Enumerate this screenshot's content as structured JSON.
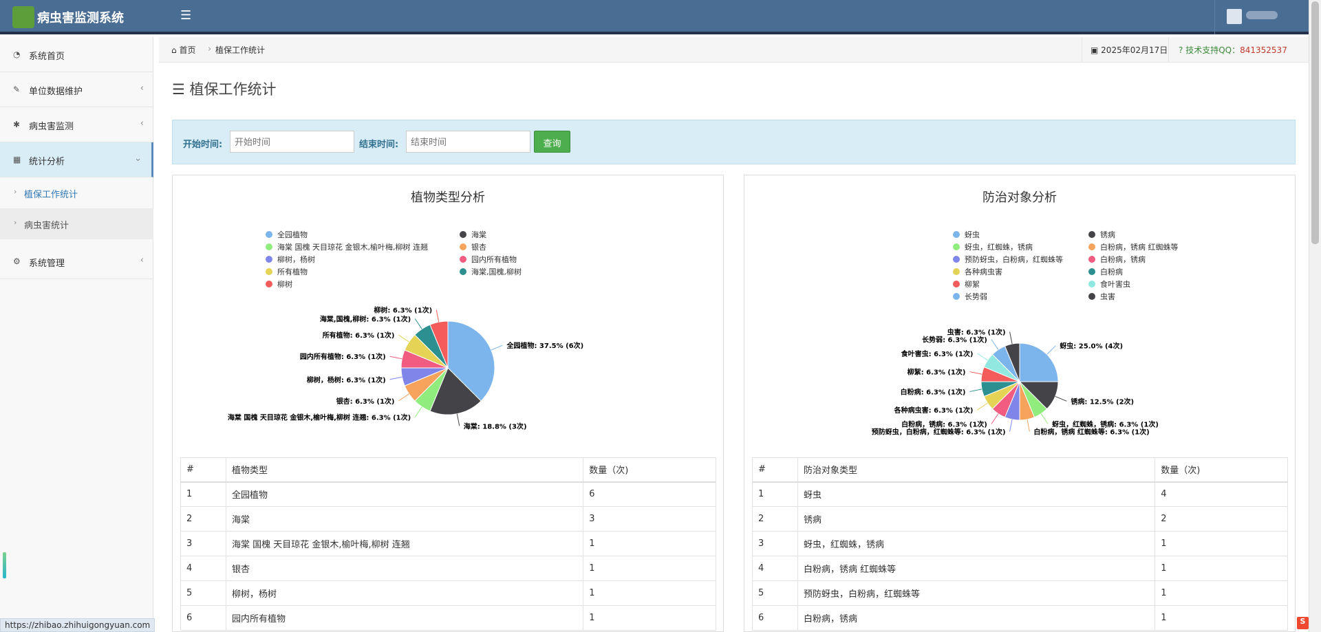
{
  "header": {
    "app_title": "病虫害监测系统",
    "menu_icon": "hamburger-icon"
  },
  "sidebar": {
    "items": [
      {
        "label": "系统首页",
        "icon": "dashboard-icon"
      },
      {
        "label": "单位数据维护",
        "icon": "edit-icon"
      },
      {
        "label": "病虫害监测",
        "icon": "bug-icon"
      },
      {
        "label": "统计分析",
        "icon": "chart-icon"
      },
      {
        "label": "系统管理",
        "icon": "gears-icon"
      }
    ],
    "subitems": [
      {
        "label": "植保工作统计"
      },
      {
        "label": "病虫害统计"
      }
    ]
  },
  "breadcrumb": {
    "home": "首页",
    "current": "植保工作统计"
  },
  "topinfo": {
    "date": "2025年02月17日",
    "support_label": "技术支持QQ：",
    "support_qq": "841352537"
  },
  "page": {
    "title": "植保工作统计"
  },
  "filter": {
    "start_label": "开始时间:",
    "start_placeholder": "开始时间",
    "end_label": "结束时间:",
    "end_placeholder": "结束时间",
    "query": "查询"
  },
  "url_hint": "https://zhibao.zhihuigongyuan.com",
  "chart_data": [
    {
      "type": "pie",
      "title": "植物类型分析",
      "slices": [
        {
          "name": "全园植物",
          "value": 6,
          "label": "全园植物: 37.5% (6次)",
          "color": "#7cb5ec"
        },
        {
          "name": "海棠",
          "value": 3,
          "label": "海棠: 18.8% (3次)",
          "color": "#434348"
        },
        {
          "name": "海棠 国槐 天目琼花 金银木,榆叶梅,柳树 连翘",
          "value": 1,
          "label": "海棠 国槐 天目琼花 金银木,榆叶梅,柳树 连翘: 6.3% (1次)",
          "color": "#90ed7d"
        },
        {
          "name": "银杏",
          "value": 1,
          "label": "银杏: 6.3% (1次)",
          "color": "#f7a35c"
        },
        {
          "name": "柳树，杨树",
          "value": 1,
          "label": "柳树，杨树: 6.3% (1次)",
          "color": "#8085e9"
        },
        {
          "name": "园内所有植物",
          "value": 1,
          "label": "园内所有植物: 6.3% (1次)",
          "color": "#f15c80"
        },
        {
          "name": "所有植物",
          "value": 1,
          "label": "所有植物: 6.3% (1次)",
          "color": "#e4d354"
        },
        {
          "name": "海棠,国槐,柳树",
          "value": 1,
          "label": "海棠,国槐,柳树: 6.3% (1次)",
          "color": "#2b908f"
        },
        {
          "name": "柳树",
          "value": 1,
          "label": "柳树: 6.3% (1次)",
          "color": "#f45b5b"
        }
      ]
    },
    {
      "type": "pie",
      "title": "防治对象分析",
      "slices": [
        {
          "name": "蚜虫",
          "value": 4,
          "label": "蚜虫: 25.0% (4次)",
          "color": "#7cb5ec"
        },
        {
          "name": "锈病",
          "value": 2,
          "label": "锈病: 12.5% (2次)",
          "color": "#434348"
        },
        {
          "name": "蚜虫，红蜘蛛，锈病",
          "value": 1,
          "label": "蚜虫，红蜘蛛，锈病: 6.3% (1次)",
          "color": "#90ed7d"
        },
        {
          "name": "白粉病，锈病 红蜘蛛等",
          "value": 1,
          "label": "白粉病，锈病 红蜘蛛等: 6.3% (1次)",
          "color": "#f7a35c"
        },
        {
          "name": "预防蚜虫，白粉病，红蜘蛛等",
          "value": 1,
          "label": "预防蚜虫，白粉病，红蜘蛛等: 6.3% (1次)",
          "color": "#8085e9"
        },
        {
          "name": "白粉病，锈病",
          "value": 1,
          "label": "白粉病，锈病: 6.3% (1次)",
          "color": "#f15c80"
        },
        {
          "name": "各种病虫害",
          "value": 1,
          "label": "各种病虫害: 6.3% (1次)",
          "color": "#e4d354"
        },
        {
          "name": "白粉病",
          "value": 1,
          "label": "白粉病: 6.3% (1次)",
          "color": "#2b908f"
        },
        {
          "name": "柳絮",
          "value": 1,
          "label": "柳絮: 6.3% (1次)",
          "color": "#f45b5b"
        },
        {
          "name": "食叶害虫",
          "value": 1,
          "label": "食叶害虫: 6.3% (1次)",
          "color": "#91e8e1"
        },
        {
          "name": "长势弱",
          "value": 1,
          "label": "长势弱: 6.3% (1次)",
          "color": "#7cb5ec"
        },
        {
          "name": "虫害",
          "value": 1,
          "label": "虫害: 6.3% (1次)",
          "color": "#434348"
        }
      ]
    }
  ],
  "tables": [
    {
      "headers": [
        "#",
        "植物类型",
        "数量（次)"
      ],
      "rows": [
        [
          "1",
          "全园植物",
          "6"
        ],
        [
          "2",
          "海棠",
          "3"
        ],
        [
          "3",
          "海棠 国槐 天目琼花 金银木,榆叶梅,柳树 连翘",
          "1"
        ],
        [
          "4",
          "银杏",
          "1"
        ],
        [
          "5",
          "柳树，杨树",
          "1"
        ],
        [
          "6",
          "园内所有植物",
          "1"
        ]
      ]
    },
    {
      "headers": [
        "#",
        "防治对象类型",
        "数量（次)"
      ],
      "rows": [
        [
          "1",
          "蚜虫",
          "4"
        ],
        [
          "2",
          "锈病",
          "2"
        ],
        [
          "3",
          "蚜虫，红蜘蛛，锈病",
          "1"
        ],
        [
          "4",
          "白粉病，锈病 红蜘蛛等",
          "1"
        ],
        [
          "5",
          "预防蚜虫，白粉病，红蜘蛛等",
          "1"
        ],
        [
          "6",
          "白粉病，锈病",
          "1"
        ]
      ]
    }
  ]
}
